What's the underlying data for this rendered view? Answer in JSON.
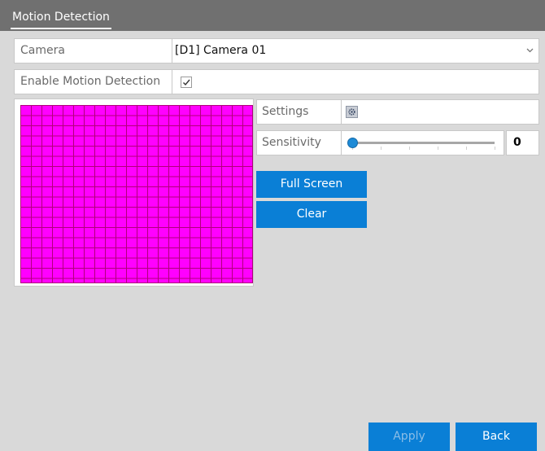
{
  "header": {
    "tab_label": "Motion Detection"
  },
  "camera": {
    "label": "Camera",
    "selected": "[D1] Camera 01"
  },
  "enable_motion": {
    "label": "Enable Motion Detection",
    "checked": true
  },
  "settings": {
    "label": "Settings",
    "icon": "gear-icon"
  },
  "sensitivity": {
    "label": "Sensitivity",
    "value": "0"
  },
  "buttons": {
    "full_screen": "Full Screen",
    "clear": "Clear",
    "apply": "Apply",
    "back": "Back"
  },
  "colors": {
    "accent": "#0a7fd6",
    "grid_fill": "#ff00ff",
    "titlebar": "#707070",
    "panel_bg": "#d9d9d9"
  }
}
